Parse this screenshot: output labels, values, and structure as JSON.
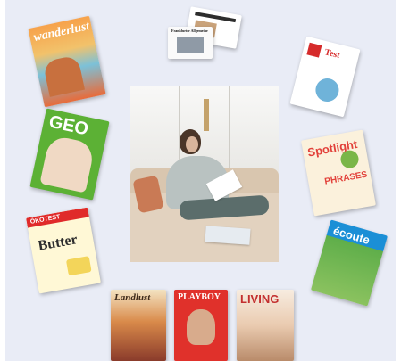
{
  "magazines": {
    "wanderlust": {
      "masthead": "wanderlust",
      "icon": "magazine-cover-icon"
    },
    "newspapers": {
      "masthead": "Frankfurter Allgemeine",
      "icon": "newspaper-icon"
    },
    "finanztest": {
      "masthead": "Test",
      "icon": "magazine-cover-icon"
    },
    "geo": {
      "masthead": "GEO",
      "icon": "magazine-cover-icon"
    },
    "spotlight": {
      "masthead": "Spotlight",
      "subline": "PHRASES",
      "icon": "magazine-cover-icon"
    },
    "oekotest": {
      "masthead": "ÖKOTEST",
      "headline": "Butter",
      "icon": "magazine-cover-icon"
    },
    "ecoute": {
      "masthead": "écoute",
      "icon": "magazine-cover-icon"
    },
    "landlust": {
      "masthead": "Landlust",
      "icon": "magazine-cover-icon"
    },
    "playboy": {
      "masthead": "PLAYBOY",
      "icon": "magazine-cover-icon"
    },
    "living": {
      "masthead": "LIVING",
      "icon": "magazine-cover-icon"
    }
  },
  "colors": {
    "panel": "#e9ecf6",
    "geo_green": "#5cb135",
    "spotlight_red": "#e2413a",
    "ecoute_blue": "#1b8fd6"
  }
}
